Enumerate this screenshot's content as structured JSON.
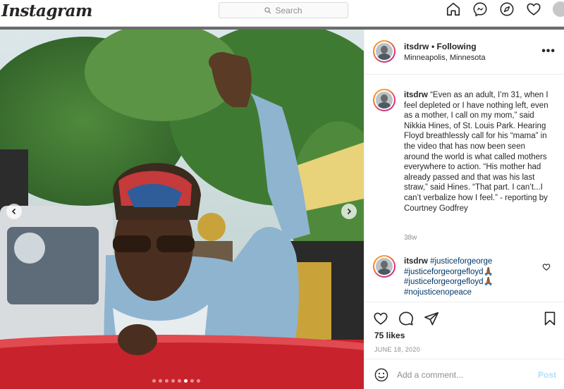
{
  "nav": {
    "logo": "Instagram",
    "search_placeholder": "Search",
    "icons": [
      "home-icon",
      "messenger-icon",
      "explore-icon",
      "heart-icon",
      "profile-avatar"
    ]
  },
  "post": {
    "username": "itsdrw",
    "following_label": "• Following",
    "location": "Minneapolis, Minnesota",
    "more_label": "•••",
    "carousel": {
      "dot_count": 8,
      "active_index": 5
    },
    "caption": {
      "username": "itsdrw",
      "text": "“Even as an adult, I’m 31, when I feel depleted or I have nothing left, even as a mother, I call on my mom,” said Nikkia Hines, of St. Louis Park. Hearing Floyd breathlessly call for his “mama” in the video that has now been seen around the world is what called mothers everywhere to action. “His mother had already passed and that was his last straw,” said Hines. “That part. I can’t...I can’t verbalize how I feel.” - reporting by Courtney Godfrey",
      "time": "38w"
    },
    "comment": {
      "username": "itsdrw",
      "tags": [
        "#justiceforgeorge",
        "#justiceforgeorgefloyd🙏🏾",
        "#justiceforgeorgefloyd🙏🏾",
        "#nojusticenopeace"
      ]
    },
    "likes": "75 likes",
    "date": "JUNE 18, 2020",
    "add_comment_placeholder": "Add a comment...",
    "post_label": "Post"
  },
  "colors": {
    "link": "#00376b",
    "post_disabled": "#b2dffc",
    "muted": "#8e8e8e"
  }
}
